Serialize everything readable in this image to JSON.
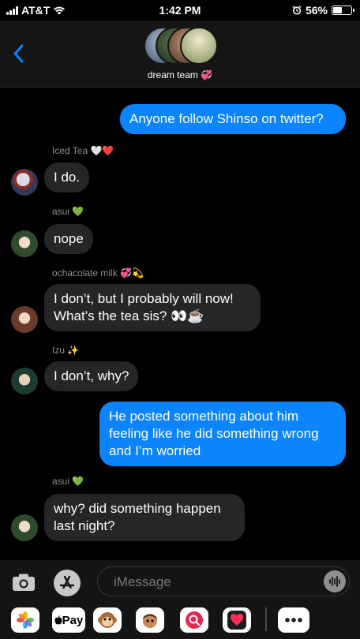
{
  "status": {
    "carrier": "AT&T",
    "time": "1:42 PM",
    "battery": "56%",
    "battery_level": 0.56
  },
  "header": {
    "group_name": "dream team 💞"
  },
  "messages": {
    "m1": "Anyone follow Shinso on twitter?",
    "s1": "Iced Tea 🤍❤️",
    "m2": "I do.",
    "s2": "asui 💚",
    "m3": "nope",
    "s3": "ochacolate milk 💞💫",
    "m4a": "I don’t, but I probably will now!",
    "m4b": "What’s the tea sis? 👀☕",
    "s4": "Izu ✨",
    "m5": "I don’t, why?",
    "m6a": "He posted something about him",
    "m6b": "feeling like he did something wrong",
    "m6c": "and I’m worried",
    "s5": "asui 💚",
    "m7a": "why? did something happen",
    "m7b": "last night?"
  },
  "input": {
    "placeholder": "iMessage"
  },
  "tray": {
    "pay_label": "Pay"
  },
  "colors": {
    "outgoing": "#0b84fe",
    "incoming": "#262628"
  },
  "icons": [
    "signal-bars-icon",
    "wifi-icon",
    "alarm-icon",
    "battery-icon",
    "back-chevron-icon",
    "camera-icon",
    "app-store-icon",
    "audio-waveform-icon",
    "photos-icon",
    "apple-pay-icon",
    "monkey-memoji-icon",
    "memoji-icon",
    "search-images-icon",
    "digital-touch-icon",
    "more-icon"
  ]
}
